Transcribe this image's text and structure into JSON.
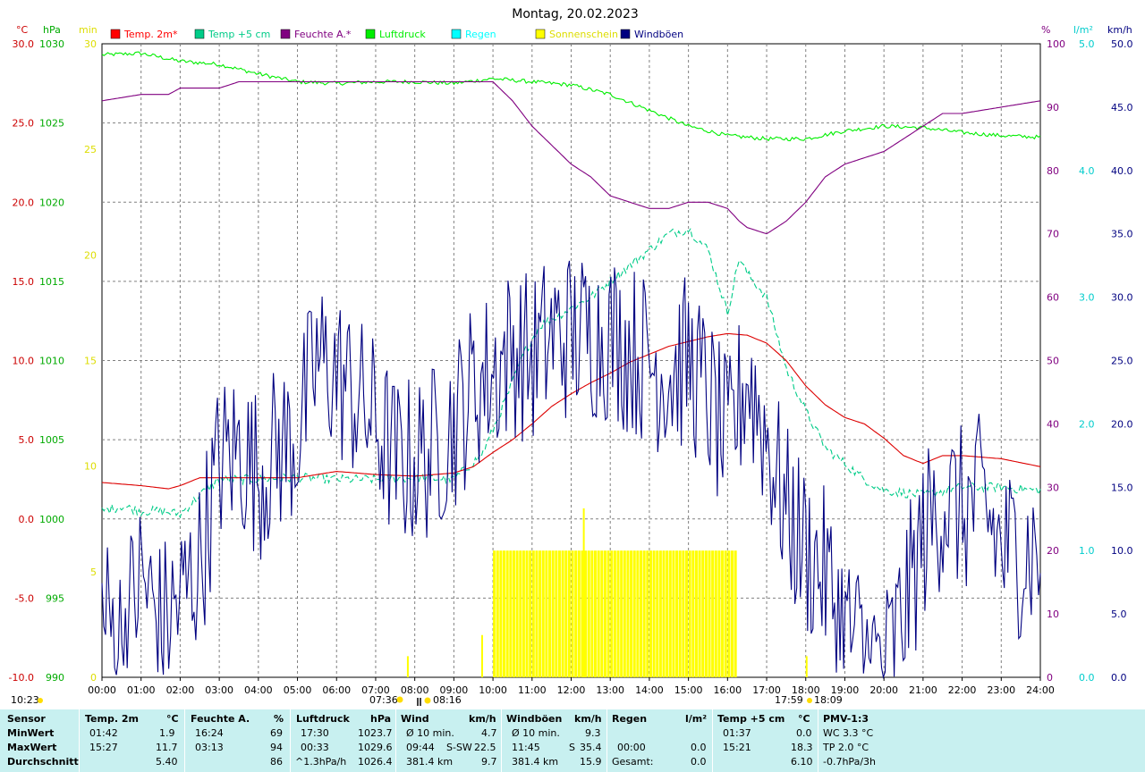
{
  "chart_data": {
    "type": "line",
    "title": "Montag, 20.02.2023",
    "x_ticks": [
      "00:00",
      "01:00",
      "02:00",
      "03:00",
      "04:00",
      "05:00",
      "06:00",
      "07:00",
      "08:00",
      "09:00",
      "10:00",
      "11:00",
      "12:00",
      "13:00",
      "14:00",
      "15:00",
      "16:00",
      "17:00",
      "18:00",
      "19:00",
      "20:00",
      "21:00",
      "22:00",
      "23:00",
      "24:00"
    ],
    "xlim_hours": [
      0,
      24
    ],
    "grid": true,
    "legend_position": "top",
    "legend": [
      {
        "label": "Temp. 2m*",
        "color": "#ff0000"
      },
      {
        "label": "Temp +5 cm",
        "color": "#00cc88"
      },
      {
        "label": "Feuchte A.*",
        "color": "#800080"
      },
      {
        "label": "Luftdruck",
        "color": "#00ee00"
      },
      {
        "label": "Regen",
        "color": "#00ffff"
      },
      {
        "label": "Sonnenschein",
        "color": "#ffff00"
      },
      {
        "label": "Windböen",
        "color": "#000080"
      }
    ],
    "axes": {
      "temp": {
        "unit": "°C",
        "range": [
          -10,
          30
        ],
        "ticks": [
          "30.0",
          "25.0",
          "20.0",
          "15.0",
          "10.0",
          "5.0",
          "0.0",
          "-5.0",
          "-10.0"
        ]
      },
      "pressure": {
        "unit": "hPa",
        "range": [
          990,
          1030
        ],
        "ticks": [
          "1030",
          "1025",
          "1020",
          "1015",
          "1010",
          "1005",
          "1000",
          "995",
          "990"
        ]
      },
      "sun_minutes": {
        "unit": "min",
        "range": [
          0,
          30
        ],
        "ticks": [
          "30",
          "25",
          "20",
          "15",
          "10",
          "5",
          "0"
        ]
      },
      "humidity": {
        "unit": "%",
        "range": [
          0,
          100
        ],
        "ticks": [
          "100",
          "90",
          "80",
          "70",
          "60",
          "50",
          "40",
          "30",
          "20",
          "10",
          "0"
        ]
      },
      "rain": {
        "unit": "l/m²",
        "range": [
          0,
          5
        ],
        "ticks": [
          "5.0",
          "4.0",
          "3.0",
          "2.0",
          "1.0",
          "0.0"
        ]
      },
      "wind": {
        "unit": "km/h",
        "range": [
          0,
          50
        ],
        "ticks": [
          "50.0",
          "45.0",
          "40.0",
          "35.0",
          "30.0",
          "25.0",
          "20.0",
          "15.0",
          "10.0",
          "5.0",
          "0.0"
        ]
      }
    },
    "series": [
      {
        "name": "Temp. 2m*",
        "axis": "temp",
        "color": "#dd0000",
        "points": [
          [
            0,
            2.3
          ],
          [
            1,
            2.1
          ],
          [
            1.7,
            1.9
          ],
          [
            2,
            2.1
          ],
          [
            2.5,
            2.6
          ],
          [
            3,
            2.6
          ],
          [
            4,
            2.6
          ],
          [
            5,
            2.6
          ],
          [
            6,
            3.0
          ],
          [
            7,
            2.8
          ],
          [
            8,
            2.7
          ],
          [
            9,
            2.9
          ],
          [
            9.5,
            3.3
          ],
          [
            10,
            4.2
          ],
          [
            10.5,
            5.0
          ],
          [
            11,
            6.0
          ],
          [
            11.5,
            7.1
          ],
          [
            12,
            7.9
          ],
          [
            12.5,
            8.6
          ],
          [
            13,
            9.2
          ],
          [
            13.5,
            9.9
          ],
          [
            14,
            10.4
          ],
          [
            14.5,
            10.9
          ],
          [
            15,
            11.2
          ],
          [
            15.5,
            11.5
          ],
          [
            16,
            11.7
          ],
          [
            16.5,
            11.6
          ],
          [
            17,
            11.1
          ],
          [
            17.5,
            10.0
          ],
          [
            18,
            8.4
          ],
          [
            18.5,
            7.2
          ],
          [
            19,
            6.4
          ],
          [
            19.5,
            6.0
          ],
          [
            20,
            5.1
          ],
          [
            20.5,
            4.0
          ],
          [
            21,
            3.5
          ],
          [
            21.5,
            4.0
          ],
          [
            22,
            4.0
          ],
          [
            23,
            3.8
          ],
          [
            24,
            3.3
          ]
        ]
      },
      {
        "name": "Temp +5 cm",
        "axis": "temp",
        "color": "#00cc88",
        "dashed": true,
        "points": [
          [
            0,
            0.5
          ],
          [
            0.5,
            0.8
          ],
          [
            1,
            0.5
          ],
          [
            1.5,
            0.5
          ],
          [
            2,
            0.3
          ],
          [
            2.5,
            1.5
          ],
          [
            3,
            2.5
          ],
          [
            4,
            2.5
          ],
          [
            5,
            2.6
          ],
          [
            6,
            2.5
          ],
          [
            7,
            2.5
          ],
          [
            8,
            2.6
          ],
          [
            9,
            2.5
          ],
          [
            9.7,
            4.0
          ],
          [
            10,
            5.6
          ],
          [
            10.4,
            8.0
          ],
          [
            10.8,
            10.5
          ],
          [
            11.2,
            12.2
          ],
          [
            12,
            13.3
          ],
          [
            12.5,
            14.0
          ],
          [
            13,
            15.0
          ],
          [
            13.5,
            16.0
          ],
          [
            14,
            17.0
          ],
          [
            14.5,
            18.0
          ],
          [
            15,
            18.3
          ],
          [
            15.3,
            17.5
          ],
          [
            15.5,
            17.0
          ],
          [
            16,
            13.0
          ],
          [
            16.3,
            16.5
          ],
          [
            16.5,
            15.5
          ],
          [
            17,
            14.0
          ],
          [
            17.5,
            9.5
          ],
          [
            18,
            6.8
          ],
          [
            18.5,
            4.5
          ],
          [
            19,
            3.5
          ],
          [
            19.5,
            2.5
          ],
          [
            20,
            1.8
          ],
          [
            21,
            1.5
          ],
          [
            22,
            2.0
          ],
          [
            23,
            2.0
          ],
          [
            24,
            1.8
          ]
        ]
      },
      {
        "name": "Feuchte A.*",
        "axis": "humidity",
        "color": "#800080",
        "points": [
          [
            0,
            91
          ],
          [
            1,
            92
          ],
          [
            1.7,
            92
          ],
          [
            2,
            93
          ],
          [
            3,
            93
          ],
          [
            3.5,
            94
          ],
          [
            4,
            94
          ],
          [
            5,
            94
          ],
          [
            6,
            94
          ],
          [
            7,
            94
          ],
          [
            8,
            94
          ],
          [
            9,
            94
          ],
          [
            10,
            94
          ],
          [
            10.5,
            91
          ],
          [
            11,
            87
          ],
          [
            11.5,
            84
          ],
          [
            12,
            81
          ],
          [
            12.5,
            79
          ],
          [
            13,
            76
          ],
          [
            13.5,
            75
          ],
          [
            14,
            74
          ],
          [
            14.5,
            74
          ],
          [
            15,
            75
          ],
          [
            15.5,
            75
          ],
          [
            16,
            74
          ],
          [
            16.3,
            72
          ],
          [
            16.5,
            71
          ],
          [
            17,
            70
          ],
          [
            17.5,
            72
          ],
          [
            18,
            75
          ],
          [
            18.5,
            79
          ],
          [
            19,
            81
          ],
          [
            19.5,
            82
          ],
          [
            20,
            83
          ],
          [
            20.5,
            85
          ],
          [
            21,
            87
          ],
          [
            21.5,
            89
          ],
          [
            22,
            89
          ],
          [
            23,
            90
          ],
          [
            24,
            91
          ]
        ]
      },
      {
        "name": "Luftdruck",
        "axis": "pressure",
        "color": "#00ee00",
        "points": [
          [
            0,
            1029.3
          ],
          [
            1,
            1029.4
          ],
          [
            2,
            1028.9
          ],
          [
            3,
            1028.7
          ],
          [
            4,
            1028.1
          ],
          [
            5,
            1027.6
          ],
          [
            6,
            1027.5
          ],
          [
            7,
            1027.6
          ],
          [
            8,
            1027.6
          ],
          [
            9,
            1027.5
          ],
          [
            10,
            1027.8
          ],
          [
            11,
            1027.6
          ],
          [
            12,
            1027.4
          ],
          [
            13,
            1026.8
          ],
          [
            14,
            1025.8
          ],
          [
            15,
            1024.8
          ],
          [
            16,
            1024.2
          ],
          [
            17,
            1024.0
          ],
          [
            18,
            1024.0
          ],
          [
            19,
            1024.5
          ],
          [
            20,
            1024.8
          ],
          [
            21,
            1024.7
          ],
          [
            22,
            1024.4
          ],
          [
            23,
            1024.2
          ],
          [
            24,
            1024.1
          ]
        ]
      },
      {
        "name": "Windböen",
        "axis": "wind",
        "color": "#000080",
        "noisy": true,
        "points": [
          [
            0,
            5
          ],
          [
            0.5,
            3
          ],
          [
            1,
            8
          ],
          [
            1.5,
            4
          ],
          [
            2,
            6
          ],
          [
            2.5,
            9
          ],
          [
            3,
            17
          ],
          [
            3.5,
            18
          ],
          [
            4,
            16
          ],
          [
            4.5,
            18
          ],
          [
            5,
            19
          ],
          [
            5.5,
            25
          ],
          [
            6,
            24
          ],
          [
            7,
            20
          ],
          [
            7.5,
            17
          ],
          [
            8,
            17
          ],
          [
            8.5,
            18
          ],
          [
            9,
            20
          ],
          [
            9.5,
            23
          ],
          [
            10,
            24
          ],
          [
            10.5,
            26
          ],
          [
            11,
            25
          ],
          [
            11.5,
            27
          ],
          [
            12,
            27
          ],
          [
            12.5,
            27
          ],
          [
            13,
            27
          ],
          [
            13.5,
            26
          ],
          [
            14,
            25
          ],
          [
            14.5,
            24
          ],
          [
            15,
            25
          ],
          [
            15.5,
            22
          ],
          [
            16,
            18
          ],
          [
            16.5,
            24
          ],
          [
            17,
            19
          ],
          [
            17.5,
            13
          ],
          [
            18,
            10
          ],
          [
            18.5,
            8
          ],
          [
            19,
            4
          ],
          [
            19.5,
            2
          ],
          [
            20,
            0.5
          ],
          [
            20.5,
            5
          ],
          [
            21,
            11
          ],
          [
            21.5,
            14
          ],
          [
            22,
            13
          ],
          [
            22.5,
            14
          ],
          [
            23,
            10
          ],
          [
            24,
            10
          ]
        ]
      }
    ],
    "sunshine": {
      "axis": "sun_minutes",
      "color": "#ffff00",
      "value_min": 6,
      "from_hour": 10.0,
      "to_hour": 16.2,
      "extra": [
        [
          7.8,
          1
        ],
        [
          9.7,
          2
        ],
        [
          12.3,
          8
        ],
        [
          18.0,
          1
        ]
      ]
    },
    "rain_values": [],
    "annotations": {
      "sunrise": "07:36",
      "transit": "08:16",
      "sunset": "17:59",
      "moon": "18:09",
      "corner_time": "10:23"
    },
    "units": {
      "temp": "°C",
      "pressure": "hPa",
      "sun": "min",
      "humidity": "%",
      "rain": "l/m²",
      "wind": "km/h"
    }
  },
  "stats": {
    "sensor": {
      "header": "Sensor",
      "rows": [
        "MinWert",
        "MaxWert",
        "Durchschnitt"
      ]
    },
    "temp2m": {
      "header": "Temp. 2m",
      "unit": "°C",
      "min_time": "01:42",
      "min": "1.9",
      "max_time": "15:27",
      "max": "11.7",
      "avg": "5.40"
    },
    "humidity": {
      "header": "Feuchte A.",
      "unit": "%",
      "min_time": "16:24",
      "min": "69",
      "max_time": "03:13",
      "max": "94",
      "avg": "86"
    },
    "pressure": {
      "header": "Luftdruck",
      "unit": "hPa",
      "min_time": "17:30",
      "min": "1023.7",
      "max_time": "00:33",
      "max": "1029.6",
      "trend": "^1.3hPa/h",
      "avg": "1026.4"
    },
    "wind": {
      "header": "Wind",
      "unit": "km/h",
      "r1_label": "Ø 10 min.",
      "r1_value": "4.7",
      "r2_time": "09:44",
      "r2_dir": "S-SW",
      "r2_value": "22.5",
      "r3_label": "381.4 km",
      "r3_value": "9.7"
    },
    "gusts": {
      "header": "Windböen",
      "unit": "km/h",
      "r1_label": "Ø 10 min.",
      "r1_value": "9.3",
      "r2_time": "11:45",
      "r2_dir": "S",
      "r2_value": "35.4",
      "r3_label": "381.4 km",
      "r3_value": "15.9"
    },
    "rain": {
      "header": "Regen",
      "unit": "l/m²",
      "r2_time": "00:00",
      "r2_value": "0.0",
      "r3_label": "Gesamt:",
      "r3_value": "0.0"
    },
    "temp5": {
      "header": "Temp +5 cm",
      "unit": "°C",
      "min_time": "01:37",
      "min": "0.0",
      "max_time": "15:21",
      "max": "18.3",
      "avg": "6.10"
    },
    "pmv": {
      "header": "PMV-1:3",
      "r1": "WC 3.3 °C",
      "r2": "TP 2.0 °C",
      "r3": "-0.7hPa/3h"
    }
  }
}
